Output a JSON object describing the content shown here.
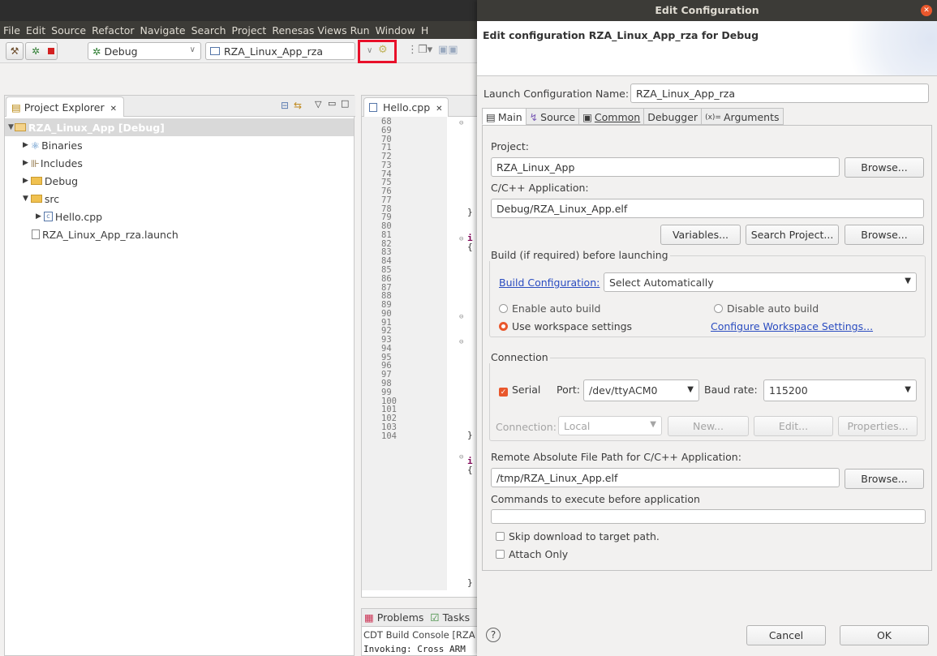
{
  "menu": [
    "File",
    "Edit",
    "Source",
    "Refactor",
    "Navigate",
    "Search",
    "Project",
    "Renesas Views",
    "Run",
    "Window",
    "H"
  ],
  "toolbar": {
    "build_config": "Debug",
    "launch_config": "RZA_Linux_App_rza"
  },
  "explorer": {
    "title": "Project Explorer",
    "tree": [
      {
        "label": "RZA_Linux_App [Debug]",
        "level": 0
      },
      {
        "label": "Binaries",
        "level": 1
      },
      {
        "label": "Includes",
        "level": 1
      },
      {
        "label": "Debug",
        "level": 1
      },
      {
        "label": "src",
        "level": 1
      },
      {
        "label": "Hello.cpp",
        "level": 2
      },
      {
        "label": "RZA_Linux_App_rza.launch",
        "level": 1
      }
    ]
  },
  "editor": {
    "tab": "Hello.cpp",
    "lines": [
      "68",
      "69",
      "70",
      "71",
      "72",
      "73",
      "74",
      "75",
      "76",
      "77",
      "78",
      "79",
      "80",
      "81",
      "82",
      "83",
      "84",
      "85",
      "86",
      "87",
      "88",
      "89",
      "90",
      "91",
      "92",
      "93",
      "94",
      "95",
      "96",
      "97",
      "98",
      "99",
      "100",
      "101",
      "102",
      "103",
      "104"
    ]
  },
  "bottom": {
    "tab1": "Problems",
    "tab2": "Tasks",
    "console": "CDT Build Console [RZA",
    "output": "Invoking: Cross ARM"
  },
  "dialog": {
    "title": "Edit Configuration",
    "header": "Edit configuration RZA_Linux_App_rza for Debug",
    "name_label": "Launch Configuration Name:",
    "name_value": "RZA_Linux_App_rza",
    "tabs": [
      "Main",
      "Source",
      "Common",
      "Debugger",
      "Arguments"
    ],
    "project_label": "Project:",
    "project_value": "RZA_Linux_App",
    "browse": "Browse...",
    "app_label": "C/C++ Application:",
    "app_value": "Debug/RZA_Linux_App.elf",
    "variables": "Variables...",
    "search_project": "Search Project...",
    "build_group": "Build (if required) before launching",
    "build_config_link": "Build Configuration:",
    "build_config_value": "Select Automatically",
    "enable_auto": "Enable auto build",
    "disable_auto": "Disable auto build",
    "use_workspace": "Use workspace settings",
    "configure_ws": "Configure Workspace Settings...",
    "connection_group": "Connection",
    "serial": "Serial",
    "port_label": "Port:",
    "port_value": "/dev/ttyACM0",
    "baud_label": "Baud rate:",
    "baud_value": "115200",
    "connection_label": "Connection:",
    "connection_value": "Local",
    "new_btn": "New...",
    "edit_btn": "Edit...",
    "properties_btn": "Properties...",
    "remote_label": "Remote Absolute File Path for C/C++ Application:",
    "remote_value": "/tmp/RZA_Linux_App.elf",
    "commands_label": "Commands to execute before application",
    "commands_value": "",
    "skip_download": "Skip download to target path.",
    "attach_only": "Attach Only",
    "help": "?",
    "cancel": "Cancel",
    "ok": "OK"
  }
}
